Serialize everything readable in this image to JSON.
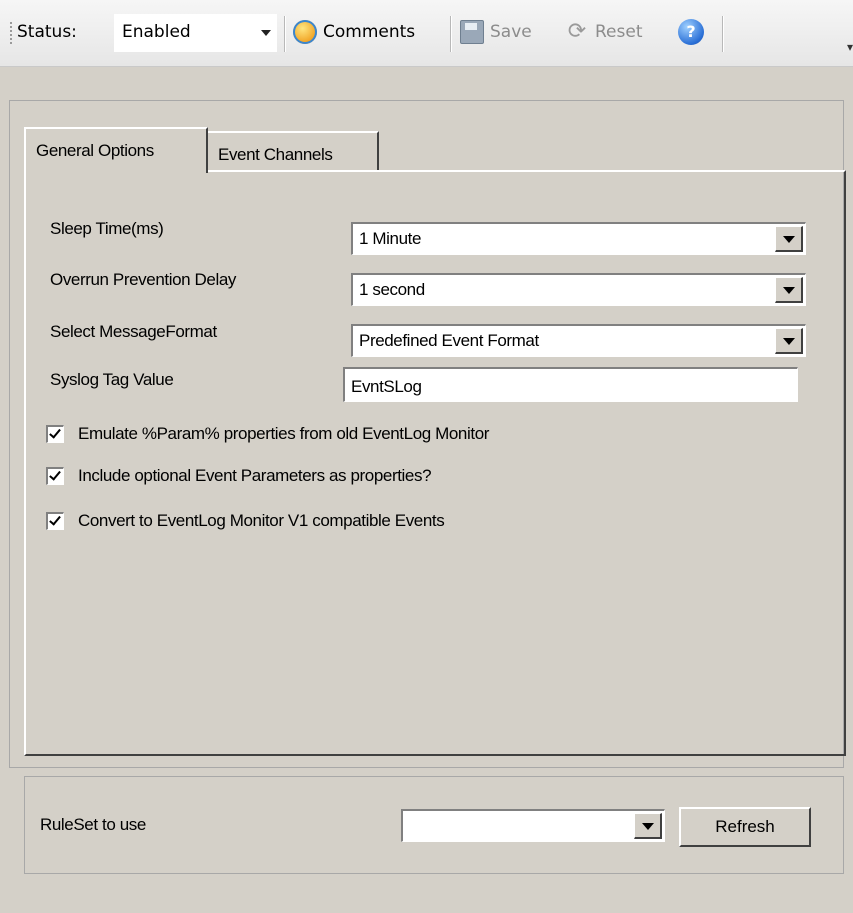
{
  "toolbar": {
    "status_label": "Status:",
    "status_value": "Enabled",
    "comments_label": "Comments",
    "save_label": "Save",
    "reset_label": "Reset"
  },
  "tabs": [
    {
      "label": "General Options",
      "active": true
    },
    {
      "label": "Event Channels",
      "active": false
    }
  ],
  "general": {
    "sleep_time_label": "Sleep Time(ms)",
    "sleep_time_value": "1 Minute",
    "overrun_label": "Overrun Prevention Delay",
    "overrun_value": "1 second",
    "message_format_label": "Select MessageFormat",
    "message_format_value": "Predefined Event Format",
    "syslog_tag_label": "Syslog Tag Value",
    "syslog_tag_value": "EvntSLog",
    "checkboxes": [
      {
        "label": "Emulate %Param% properties from old EventLog Monitor",
        "checked": true
      },
      {
        "label": "Include optional Event Parameters as properties?",
        "checked": true
      },
      {
        "label": "Convert to EventLog Monitor V1 compatible Events",
        "checked": true
      }
    ]
  },
  "ruleset": {
    "label": "RuleSet to use",
    "value": "",
    "refresh_label": "Refresh"
  },
  "colors": {
    "panel_bg": "#d4d0c8",
    "toolbar_bg": "#eeeeee",
    "help_icon": "#2a6fd6"
  }
}
